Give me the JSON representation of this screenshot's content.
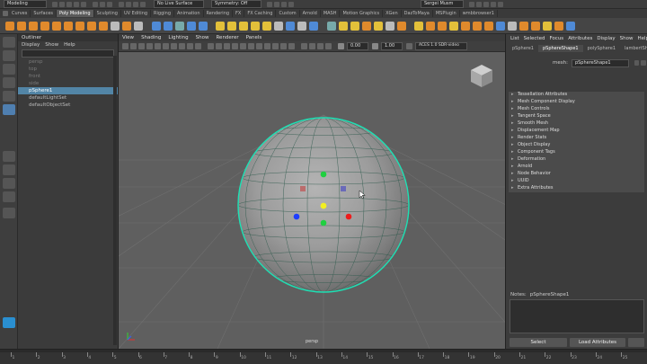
{
  "status_line": {
    "mode_dropdown": "Modeling",
    "live_surface": "No Live Surface",
    "symmetry": "Symmetry: Off",
    "user": "Sergei Musm"
  },
  "shelf_tabs": [
    "Curves",
    "Surfaces",
    "Poly Modeling",
    "Sculpting",
    "UV Editing",
    "Rigging",
    "Animation",
    "Rendering",
    "FX",
    "FX Caching",
    "Custom",
    "Arnold",
    "MASH",
    "Motion Graphics",
    "XGen",
    "DazToMaya",
    "MSPlugin",
    "wmbbrowser1"
  ],
  "active_shelf_tab": "Poly Modeling",
  "outliner": {
    "title": "Outliner",
    "menu": [
      "Display",
      "Show",
      "Help"
    ],
    "items": [
      {
        "label": "persp",
        "dim": true
      },
      {
        "label": "top",
        "dim": true
      },
      {
        "label": "front",
        "dim": true
      },
      {
        "label": "side",
        "dim": true
      },
      {
        "label": "pSphere1",
        "selected": true
      },
      {
        "label": "defaultLightSet"
      },
      {
        "label": "defaultObjectSet"
      }
    ]
  },
  "viewport": {
    "menu": [
      "View",
      "Shading",
      "Lighting",
      "Show",
      "Renderer",
      "Panels"
    ],
    "camera_label": "persp",
    "exposure": "0.00",
    "gamma": "1.00",
    "color_space": "ACES 1.0 SDR-video"
  },
  "attribute_editor": {
    "menu": [
      "List",
      "Selected",
      "Focus",
      "Attributes",
      "Display",
      "Show",
      "Help"
    ],
    "tabs": [
      "pSphere1",
      "pSphereShape1",
      "polySphere1",
      "lambertShading"
    ],
    "active_tab": "pSphereShape1",
    "mesh_label": "mesh:",
    "mesh_value": "pSphereShape1",
    "sections": [
      "Tessellation Attributes",
      "Mesh Component Display",
      "Mesh Controls",
      "Tangent Space",
      "Smooth Mesh",
      "Displacement Map",
      "Render Stats",
      "Object Display",
      "Component Tags",
      "Deformation",
      "Arnold",
      "Node Behavior",
      "UUID",
      "Extra Attributes"
    ],
    "notes_label": "Notes:",
    "notes_value": "pSphereShape1",
    "select_button": "Select",
    "load_attributes_button": "Load Attributes"
  },
  "timeline": {
    "ticks": [
      "1",
      "2",
      "3",
      "4",
      "5",
      "6",
      "7",
      "8",
      "9",
      "10",
      "11",
      "12",
      "13",
      "14",
      "15",
      "16",
      "17",
      "18",
      "19",
      "20",
      "21",
      "22",
      "23",
      "24",
      "25"
    ]
  }
}
